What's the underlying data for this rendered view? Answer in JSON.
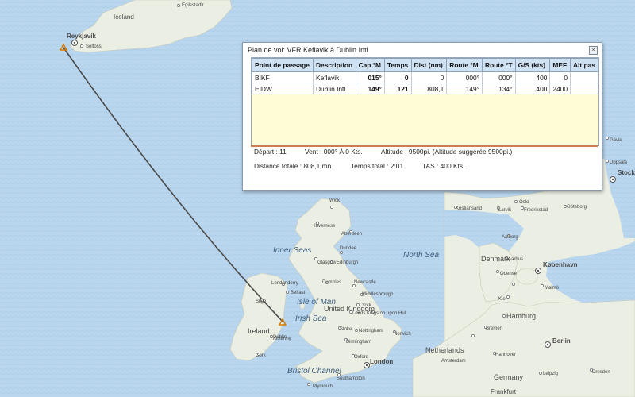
{
  "map": {
    "labels": {
      "iceland": "Iceland",
      "egilsstadir": "Egilsstadir",
      "reykjavik": "Reykjavík",
      "selfoss": "Selfoss",
      "wick": "Wick",
      "inverness": "Inverness",
      "aberdeen": "Aberdeen",
      "inner_seas": "Inner Seas",
      "glasgow": "Glasgow",
      "edinburgh": "Edinburgh",
      "dundee": "Dundee",
      "londonderry": "Londonderry",
      "belfast": "Belfast",
      "sligo": "Sligo",
      "isle_of_man": "Isle of Man",
      "irish_sea": "Irish Sea",
      "ireland": "Ireland",
      "dublin": "Dublin",
      "kilkenny": "Kilkenny",
      "cork": "Cork",
      "dumfries": "Dumfries",
      "newcastle": "Newcastle",
      "middlesbrough": "Middlesbrough",
      "york": "York",
      "leeds": "Leeds",
      "hull": "Kingston upon Hull",
      "united_kingdom": "United Kingdom",
      "stoke": "Stoke",
      "nottingham": "Nottingham",
      "birmingham": "Birmingham",
      "oxford": "Oxford",
      "london": "London",
      "norwich": "Norwich",
      "southampton": "Southampton",
      "plymouth": "Plymouth",
      "bristol_channel": "Bristol Channel",
      "north_sea": "North Sea",
      "kristiansand": "Kristiansand",
      "larvik": "Larvik",
      "oslo": "Oslo",
      "fredrikstad": "Fredrikstad",
      "goteborg": "Göteborg",
      "denmark": "Denmark",
      "kobenhavn": "København",
      "aalborg": "Aalborg",
      "aarhus": "Aarhus",
      "odense": "Odense",
      "malmo": "Malmö",
      "stockh": "Stockh",
      "uppsala": "Uppsala",
      "gavle": "Gävle",
      "hamburg": "Hamburg",
      "bremen": "Bremen",
      "berlin": "Berlin",
      "netherlands": "Netherlands",
      "amsterdam": "Amsterdam",
      "germany": "Germany",
      "frankfurt": "Frankfurt",
      "hannover": "Hannover",
      "kiel": "Kiel",
      "leipzig": "Leipzig",
      "dresden": "Dresden"
    }
  },
  "panel": {
    "title": "Plan de vol: VFR Keflavik à Dublin Intl",
    "close": "×",
    "columns": [
      "Point de passage",
      "Description",
      "Cap °M",
      "Temps",
      "Dist (nm)",
      "Route °M",
      "Route °T",
      "G/S (kts)",
      "MEF",
      "Alt pas"
    ],
    "rows": [
      [
        "BIKF",
        "Keflavik",
        "015°",
        "0",
        "0",
        "000°",
        "000°",
        "400",
        "0",
        ""
      ],
      [
        "EIDW",
        "Dublin Intl",
        "149°",
        "121",
        "808,1",
        "149°",
        "134°",
        "400",
        "2400",
        ""
      ]
    ],
    "scroll_thumb": "|||",
    "scroll_left": "◄",
    "scroll_right": "►",
    "info": {
      "depart": "Départ :  11",
      "vent": "Vent :  000° À 0 Kts.",
      "altitude": "Altitude :  9500pi. (Altitude suggérée 9500pi.)",
      "distance": "Distance totale :  808,1 mn",
      "temps": "Temps total :  2:01",
      "tas": "TAS :  400 Kts."
    }
  }
}
